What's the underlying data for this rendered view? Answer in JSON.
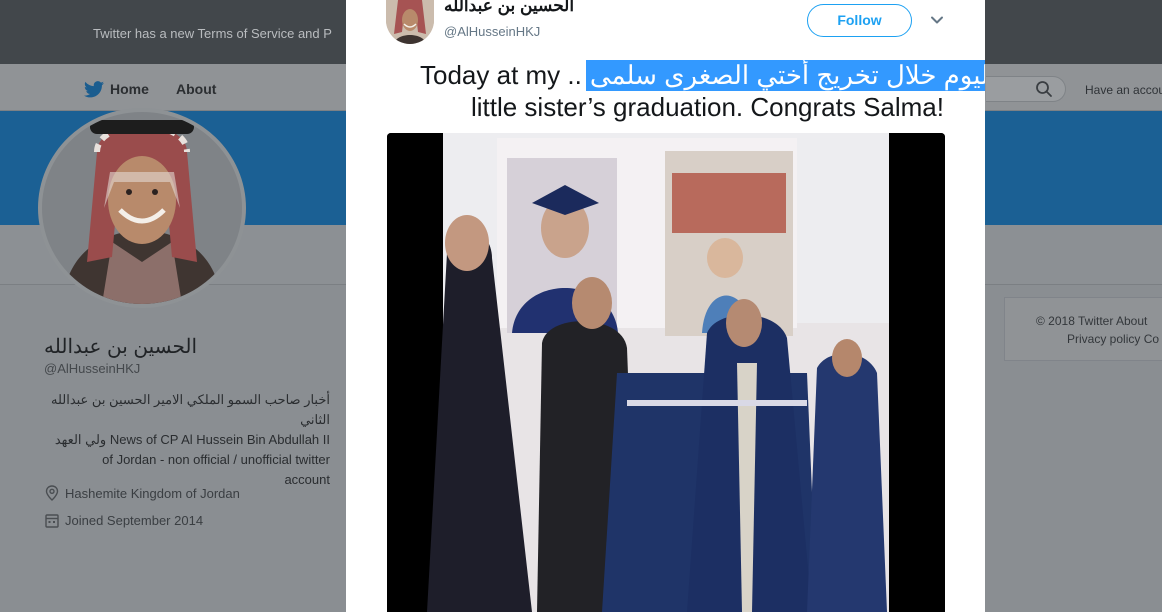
{
  "background_page": {
    "notice": "Twitter has a new Terms of Service and P",
    "nav": {
      "home": "Home",
      "about": "About"
    },
    "search_placeholder": "",
    "have_account": "Have an accou",
    "profile": {
      "name": "الحسين بن عبدالله",
      "handle": "@AlHusseinHKJ",
      "bio_lines": [
        "أخبار صاحب السمو الملكي الامير الحسين بن عبدالله الثاني",
        "ولي العهد News of CP Al Hussein Bin Abdullah II",
        "of Jordan - non official / unofficial twitter",
        "account"
      ],
      "location": "Hashemite Kingdom of Jordan",
      "joined": "Joined September 2014"
    },
    "footer": {
      "line1": "© 2018 Twitter   About",
      "line2": "Privacy policy   Co"
    }
  },
  "tweet": {
    "author_name": "الحسين بن عبدالله",
    "author_handle": "@AlHusseinHKJ",
    "follow_label": "Follow",
    "text_en_1": "Today at my ..",
    "text_ar_selected": "اليوم خلال تخريج أختي الصغرى سلمى",
    "text_en_2": "little sister’s graduation. Congrats Salma!"
  },
  "colors": {
    "accent": "#1da1f2",
    "selection": "#3399ff",
    "banner": "#1b6094",
    "topbar": "#42474b"
  },
  "icons": {
    "twitter_bird": "bird-icon",
    "search": "search-icon",
    "location": "location-pin-icon",
    "calendar": "calendar-icon",
    "caret": "chevron-down-icon"
  }
}
